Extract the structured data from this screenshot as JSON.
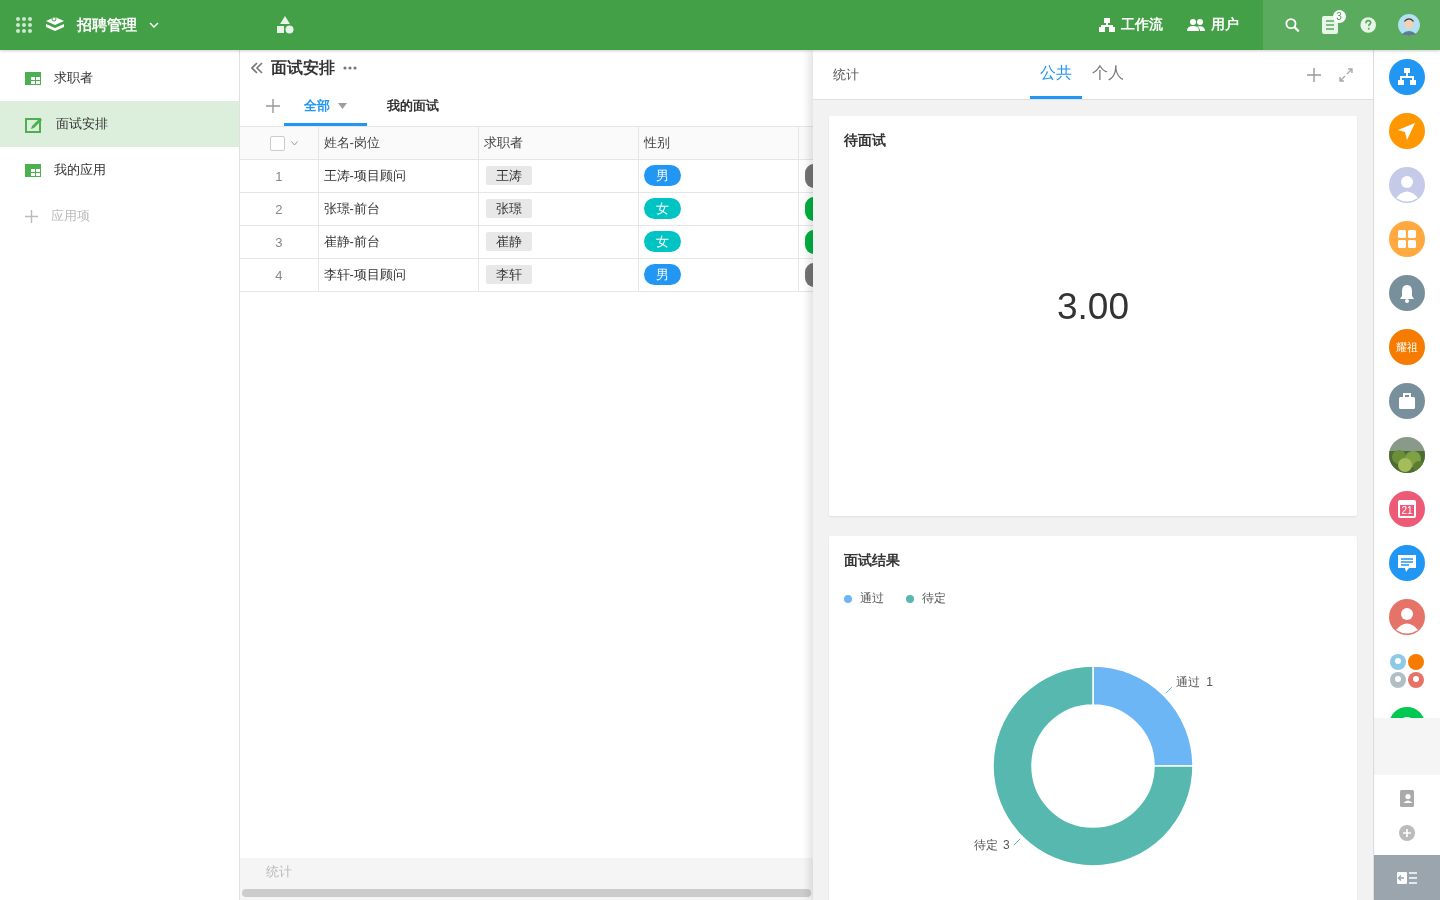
{
  "app": {
    "title": "招聘管理"
  },
  "topbar": {
    "links": [
      {
        "kind": "workflow",
        "label": "工作流"
      },
      {
        "kind": "users",
        "label": "用户"
      }
    ],
    "notification_badge": "3"
  },
  "sidebar": {
    "items": [
      {
        "kind": "table",
        "label": "求职者",
        "selected": false
      },
      {
        "kind": "edit",
        "label": "面试安排",
        "selected": true
      },
      {
        "kind": "table",
        "label": "我的应用",
        "selected": false
      }
    ],
    "add_item": "应用项"
  },
  "view": {
    "title": "面试安排",
    "tabs": [
      {
        "label": "全部",
        "selected": true
      },
      {
        "label": "我的面试",
        "selected": false
      }
    ],
    "table": {
      "select_all": {
        "checked": false
      },
      "columns": [
        "姓名-岗位",
        "求职者",
        "性别"
      ],
      "rows": [
        {
          "index": "1",
          "name_position": "王涛-项目顾问",
          "applicant": "王涛",
          "gender": {
            "label": "男",
            "color": "#2196f3"
          },
          "column_4": {
            "color": "#757575"
          }
        },
        {
          "index": "2",
          "name_position": "张璟-前台",
          "applicant": "张璟",
          "gender": {
            "label": "女",
            "color": "#00c4c4"
          },
          "column_4": {
            "color": "#00b140"
          }
        },
        {
          "index": "3",
          "name_position": "崔静-前台",
          "applicant": "崔静",
          "gender": {
            "label": "女",
            "color": "#00c4c4"
          },
          "column_4": {
            "color": "#00b140"
          }
        },
        {
          "index": "4",
          "name_position": "李轩-项目顾问",
          "applicant": "李轩",
          "gender": {
            "label": "男",
            "color": "#2196f3"
          },
          "column_4": {
            "color": "#757575"
          }
        }
      ]
    },
    "footer": "统计"
  },
  "stats_panel": {
    "title": "统计",
    "tabs": [
      {
        "label": "公共",
        "selected": true
      },
      {
        "label": "个人",
        "selected": false
      }
    ],
    "cards": [
      {
        "kind": "number",
        "title": "待面试",
        "value": "3.00"
      },
      {
        "kind": "chart",
        "title": "面试结果",
        "legend": [
          {
            "label": "通过",
            "color": "#6cb6f5"
          },
          {
            "label": "待定",
            "color": "#56b8af"
          }
        ],
        "chart_data": {
          "type": "donut",
          "categories": [
            "通过",
            "待定"
          ],
          "values": [
            1,
            3
          ],
          "data_labels": true
        }
      }
    ]
  },
  "dock": {
    "items": [
      {
        "kind": "org",
        "color": "#2196f3"
      },
      {
        "kind": "send",
        "color": "#ff9800"
      },
      {
        "kind": "avatar",
        "color": "#c5cae9"
      },
      {
        "kind": "apps",
        "color": "#ffa940"
      },
      {
        "kind": "bell",
        "color": "#78909c"
      },
      {
        "kind": "text",
        "label": "耀祖",
        "color": "#f57c00"
      },
      {
        "kind": "briefcase",
        "color": "#78909c"
      },
      {
        "kind": "picture"
      },
      {
        "kind": "calendar",
        "label": "21",
        "color": "#ec5a76"
      },
      {
        "kind": "chat",
        "color": "#2196f3"
      },
      {
        "kind": "avatar",
        "color": "#e57368"
      },
      {
        "kind": "group"
      },
      {
        "kind": "partial",
        "color": "#00c853"
      }
    ]
  }
}
